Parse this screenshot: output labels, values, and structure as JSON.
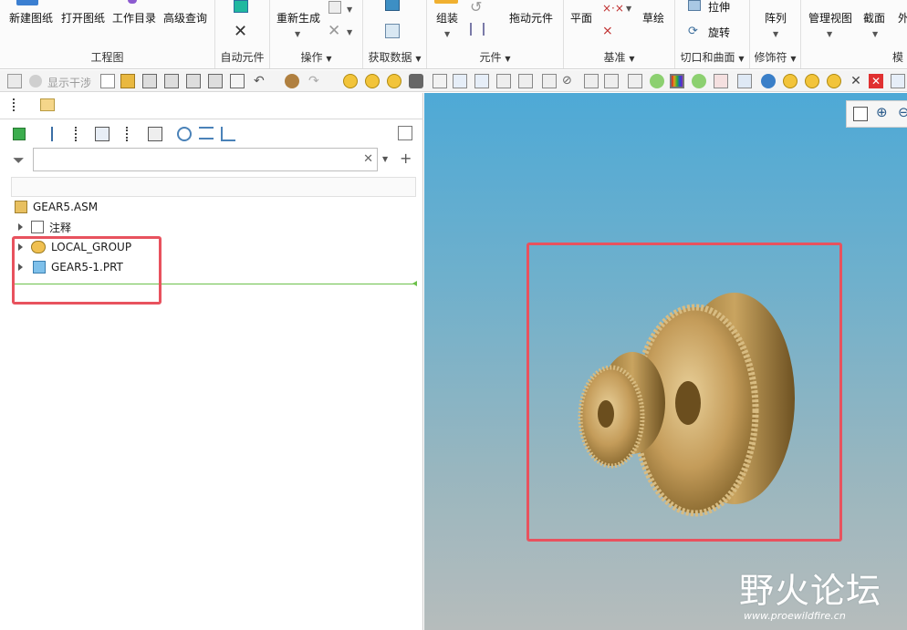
{
  "ribbon": {
    "groups": {
      "drawing": {
        "label": "工程图",
        "new": "新建图纸",
        "open": "打开图纸",
        "workdir": "工作目录",
        "search": "高级查询"
      },
      "auto": {
        "label": "自动元件"
      },
      "ops": {
        "label": "操作",
        "regen": "重新生成"
      },
      "getdata": {
        "label": "获取数据"
      },
      "comp": {
        "label": "元件",
        "assemble": "组装",
        "drag": "拖动元件"
      },
      "datum": {
        "label": "基准",
        "plane": "平面",
        "sketch": "草绘"
      },
      "cut": {
        "label": "切口和曲面",
        "extrude": "拉伸",
        "revolve": "旋转"
      },
      "modifiers": {
        "label": "修饰符",
        "pattern": "阵列"
      },
      "model": {
        "label": "模",
        "manage": "管理视图",
        "section": "截面",
        "outside": "外"
      }
    }
  },
  "qat": {
    "interference": "显示干涉"
  },
  "panel": {
    "filter_placeholder": "",
    "tree": [
      {
        "label": "GEAR5.ASM"
      },
      {
        "label": "注释"
      },
      {
        "label": "LOCAL_GROUP"
      },
      {
        "label": "GEAR5-1.PRT"
      }
    ]
  },
  "watermark": {
    "main": "野火论坛",
    "url": "www.proewildfire.cn"
  },
  "colors": {
    "accent": "#e8525e",
    "gear": "#b8924a",
    "view_top": "#4ea9d6",
    "view_bottom": "#b6bcbc",
    "green_line": "#6cc04a"
  }
}
